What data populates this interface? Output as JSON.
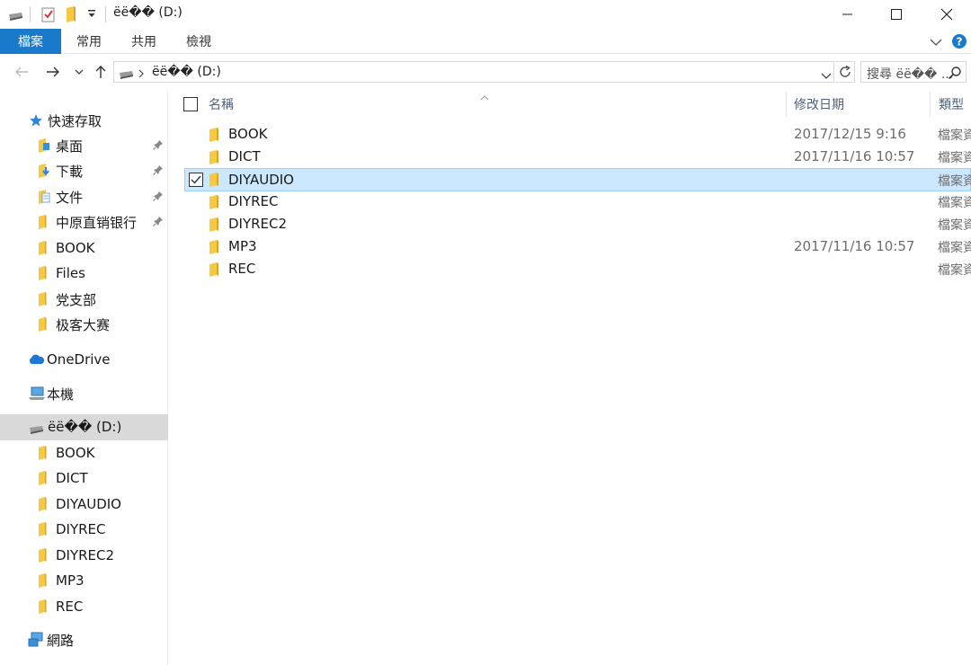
{
  "window": {
    "title": "ëë�� (D:)",
    "colors": {
      "accent": "#1979ca",
      "selected_bg": "#cce8ff",
      "folder": "#f7c843"
    }
  },
  "ribbon": {
    "tabs": [
      {
        "label": "檔案",
        "active": true
      },
      {
        "label": "常用"
      },
      {
        "label": "共用"
      },
      {
        "label": "檢視"
      }
    ]
  },
  "address": {
    "path": "ëë�� (D:)",
    "search_placeholder": "搜尋 ëë�� ..."
  },
  "nav": {
    "quick_access": {
      "label": "快速存取",
      "items": [
        {
          "label": "桌面",
          "pinned": true
        },
        {
          "label": "下載",
          "pinned": true
        },
        {
          "label": "文件",
          "pinned": true
        },
        {
          "label": "中原直销银行",
          "pinned": true
        },
        {
          "label": "BOOK"
        },
        {
          "label": "Files"
        },
        {
          "label": "党支部"
        },
        {
          "label": "极客大赛"
        }
      ]
    },
    "onedrive": "OneDrive",
    "this_pc": "本機",
    "drive": {
      "label": "ëë�� (D:)",
      "items": [
        "BOOK",
        "DICT",
        "DIYAUDIO",
        "DIYREC",
        "DIYREC2",
        "MP3",
        "REC"
      ]
    },
    "network": "網路"
  },
  "content": {
    "columns": {
      "name": "名稱",
      "date": "修改日期",
      "type": "類型"
    },
    "files": [
      {
        "name": "BOOK",
        "date": "2017/12/15 9:16",
        "type": "檔案資料夾"
      },
      {
        "name": "DICT",
        "date": "2017/11/16 10:57",
        "type": "檔案資料夾"
      },
      {
        "name": "DIYAUDIO",
        "date": "",
        "type": "檔案資料夾",
        "selected": true
      },
      {
        "name": "DIYREC",
        "date": "",
        "type": "檔案資料夾"
      },
      {
        "name": "DIYREC2",
        "date": "",
        "type": "檔案資料夾"
      },
      {
        "name": "MP3",
        "date": "2017/11/16 10:57",
        "type": "檔案資料夾"
      },
      {
        "name": "REC",
        "date": "",
        "type": "檔案資料夾"
      }
    ]
  }
}
